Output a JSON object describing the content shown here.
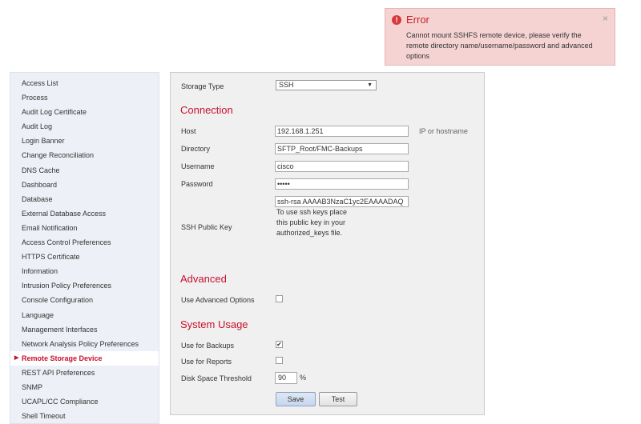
{
  "toast": {
    "title": "Error",
    "message": "Cannot mount SSHFS remote device, please verify the remote directory name/username/password and advanced options",
    "close": "×",
    "icon": "!"
  },
  "sidebar": {
    "items": [
      {
        "label": "Access List"
      },
      {
        "label": "Process"
      },
      {
        "label": "Audit Log Certificate"
      },
      {
        "label": "Audit Log"
      },
      {
        "label": "Login Banner"
      },
      {
        "label": "Change Reconciliation"
      },
      {
        "label": "DNS Cache"
      },
      {
        "label": "Dashboard"
      },
      {
        "label": "Database"
      },
      {
        "label": "External Database Access"
      },
      {
        "label": "Email Notification"
      },
      {
        "label": "Access Control Preferences"
      },
      {
        "label": "HTTPS Certificate"
      },
      {
        "label": "Information"
      },
      {
        "label": "Intrusion Policy Preferences"
      },
      {
        "label": "Console Configuration"
      },
      {
        "label": "Language"
      },
      {
        "label": "Management Interfaces"
      },
      {
        "label": "Network Analysis Policy Preferences"
      },
      {
        "label": "Remote Storage Device",
        "active": true
      },
      {
        "label": "REST API Preferences"
      },
      {
        "label": "SNMP"
      },
      {
        "label": "UCAPL/CC Compliance"
      },
      {
        "label": "Shell Timeout"
      }
    ]
  },
  "form": {
    "storage_type_label": "Storage Type",
    "storage_type_value": "SSH",
    "connection_heading": "Connection",
    "host_label": "Host",
    "host_value": "192.168.1.251",
    "host_hint": "IP or hostname",
    "directory_label": "Directory",
    "directory_value": "SFTP_Root/FMC-Backups",
    "username_label": "Username",
    "username_value": "cisco",
    "password_label": "Password",
    "password_value": "•••••",
    "ssh_key_label": "SSH Public Key",
    "ssh_key_value": "ssh-rsa AAAAB3NzaC1yc2EAAAADAQ",
    "ssh_key_help": "To use ssh keys place this public key in your authorized_keys file.",
    "advanced_heading": "Advanced",
    "use_advanced_label": "Use Advanced Options",
    "use_advanced_checked": false,
    "system_usage_heading": "System Usage",
    "use_backups_label": "Use for Backups",
    "use_backups_checked": true,
    "use_reports_label": "Use for Reports",
    "use_reports_checked": false,
    "disk_threshold_label": "Disk Space Threshold",
    "disk_threshold_value": "90",
    "disk_threshold_unit": "%",
    "save_label": "Save",
    "test_label": "Test"
  },
  "colors": {
    "accent": "#c8102e",
    "error_bg": "#f5d3d3",
    "sidebar_bg": "#edf0f6",
    "panel_bg": "#f0f0f0"
  }
}
